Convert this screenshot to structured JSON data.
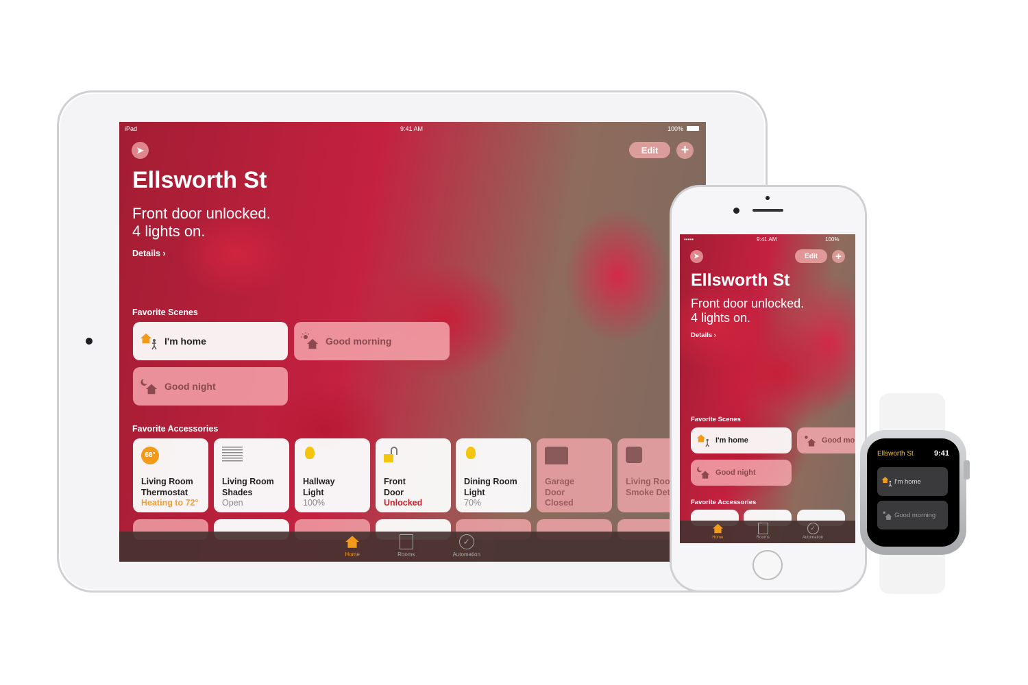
{
  "ipad": {
    "status": {
      "carrier": "iPad",
      "time": "9:41 AM",
      "battery": "100%"
    },
    "edit_label": "Edit",
    "add_label": "+",
    "title": "Ellsworth St",
    "summary_line1": "Front door unlocked.",
    "summary_line2": "4 lights on.",
    "details_label": "Details ›",
    "scenes_header": "Favorite Scenes",
    "scenes": [
      {
        "label": "I'm home",
        "icon": "house-person-icon",
        "active": true
      },
      {
        "label": "Good morning",
        "icon": "sun-house-icon",
        "active": false
      },
      {
        "label": "Good night",
        "icon": "moon-house-icon",
        "active": false
      }
    ],
    "accessories_header": "Favorite Accessories",
    "accessories": [
      {
        "line1": "Living Room",
        "line2": "Thermostat",
        "status": "Heating to 72°",
        "badge": "68°",
        "icon": "thermostat-icon",
        "active": true,
        "status_color": "#f0a030"
      },
      {
        "line1": "Living Room",
        "line2": "Shades",
        "status": "Open",
        "icon": "shades-icon",
        "active": true
      },
      {
        "line1": "Hallway",
        "line2": "Light",
        "status": "100%",
        "icon": "lightbulb-icon",
        "active": true
      },
      {
        "line1": "Front",
        "line2": "Door",
        "status": "Unlocked",
        "icon": "unlocked-padlock-icon",
        "active": true,
        "status_color": "#d0202a"
      },
      {
        "line1": "Dining Room",
        "line2": "Light",
        "status": "70%",
        "icon": "lightbulb-icon",
        "active": true
      },
      {
        "line1": "Garage",
        "line2": "Door",
        "status": "Closed",
        "icon": "garage-icon",
        "active": false
      },
      {
        "line1": "Living Roo",
        "line2": "Smoke Det",
        "status": "",
        "icon": "smoke-detector-icon",
        "active": false
      }
    ],
    "tabs": [
      {
        "label": "Home",
        "active": true
      },
      {
        "label": "Rooms",
        "active": false
      },
      {
        "label": "Automation",
        "active": false
      }
    ]
  },
  "iphone": {
    "status": {
      "signal": "•••••",
      "time": "9:41 AM",
      "battery": "100%"
    },
    "edit_label": "Edit",
    "add_label": "+",
    "title": "Ellsworth St",
    "summary_line1": "Front door unlocked.",
    "summary_line2": "4 lights on.",
    "details_label": "Details ›",
    "scenes_header": "Favorite Scenes",
    "scenes": [
      {
        "label": "I'm home",
        "active": true
      },
      {
        "label": "Good mo",
        "active": false
      },
      {
        "label": "Good night",
        "active": false
      }
    ],
    "accessories_header": "Favorite Accessories",
    "tabs": [
      {
        "label": "Home",
        "active": true
      },
      {
        "label": "Rooms",
        "active": false
      },
      {
        "label": "Automation",
        "active": false
      }
    ]
  },
  "watch": {
    "title": "Ellsworth St",
    "time": "9:41",
    "scenes": [
      {
        "label": "I'm home"
      },
      {
        "label": "Good morning"
      }
    ]
  },
  "colors": {
    "accent": "#f29a1a",
    "tile_active": "#fafafa",
    "tile_inactive": "#f4a8ac",
    "watch_title": "#f3c43a"
  }
}
